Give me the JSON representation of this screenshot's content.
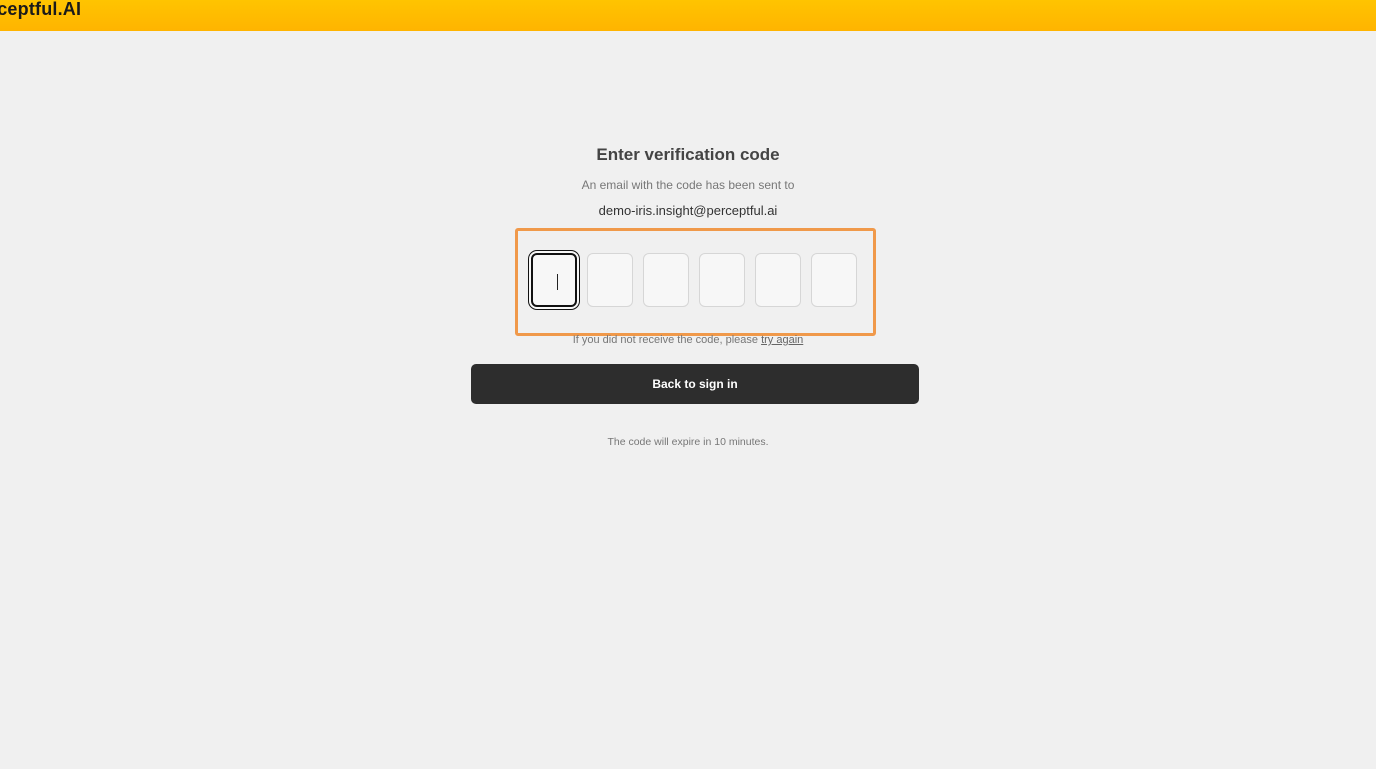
{
  "header": {
    "brand": "rceptful.AI"
  },
  "verification": {
    "title": "Enter verification code",
    "subtitle": "An email with the code has been sent to",
    "email": "demo-iris.insight@perceptful.ai",
    "digits": [
      "",
      "",
      "",
      "",
      "",
      ""
    ],
    "active_digit_index": 0,
    "resend_text": "If you did not receive the code, please",
    "resend_link": "try again",
    "back_button": "Back to sign in",
    "expiry_text": "The code will expire in 10 minutes."
  },
  "colors": {
    "header_bg": "#ffc400",
    "page_bg": "#f0f0f0",
    "button_bg": "#2d2d2d",
    "highlight_border": "#f0994a"
  }
}
